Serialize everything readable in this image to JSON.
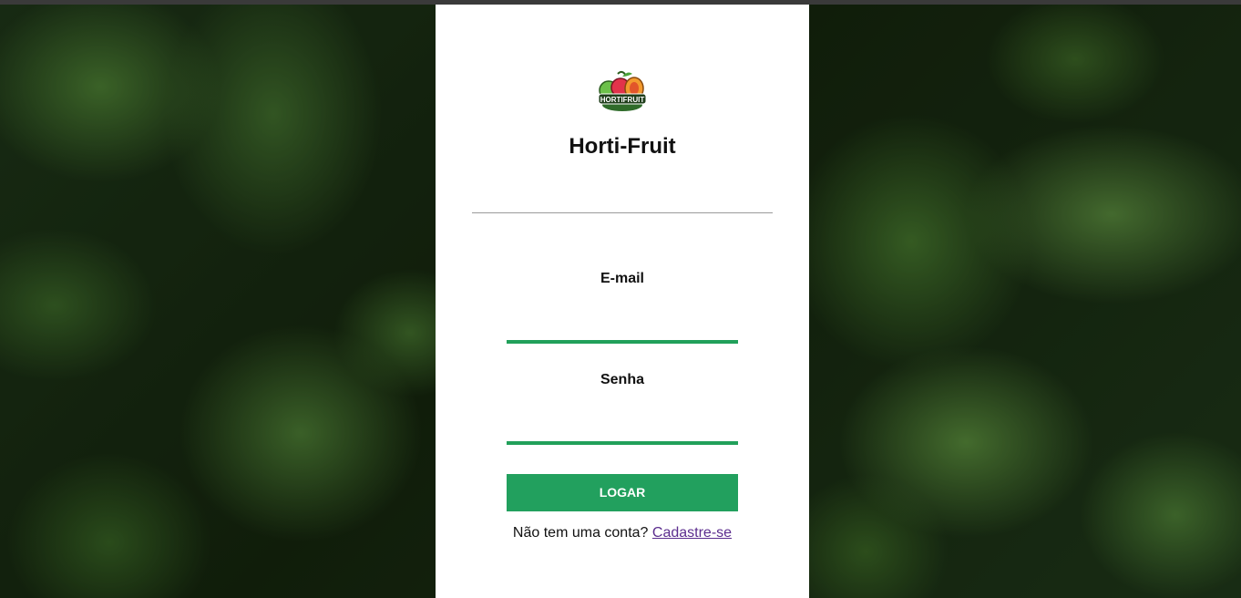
{
  "brand": {
    "logo_icon": "fruit-basket-logo",
    "logo_text": "HORTIFRUIT",
    "title": "Horti-Fruit"
  },
  "form": {
    "email_label": "E-mail",
    "email_value": "",
    "password_label": "Senha",
    "password_value": "",
    "submit_label": "LOGAR"
  },
  "signup": {
    "prompt": "Não tem uma conta?",
    "link_label": "Cadastre-se"
  },
  "colors": {
    "accent": "#22a05e",
    "link": "#5b2d8e",
    "panel": "#ffffff"
  }
}
